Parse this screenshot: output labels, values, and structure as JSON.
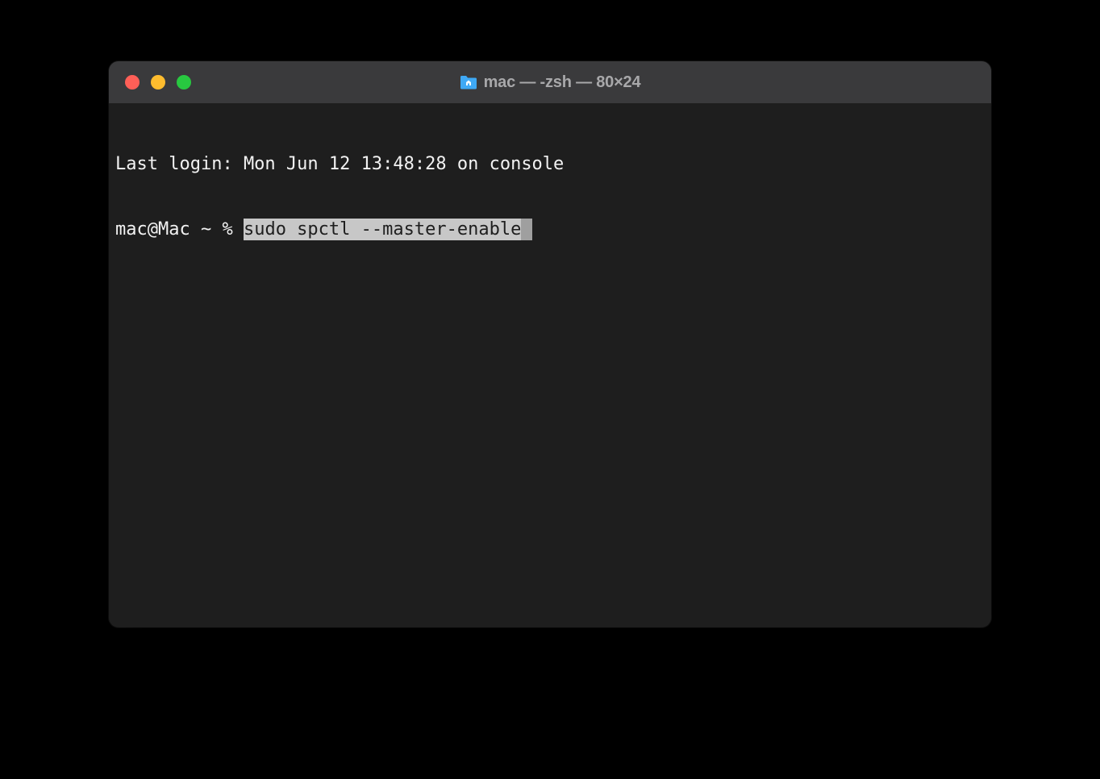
{
  "window": {
    "title": "mac — -zsh — 80×24",
    "icon": "folder-home-icon"
  },
  "terminal": {
    "login_line": "Last login: Mon Jun 12 13:48:28 on console",
    "prompt": "mac@Mac ~ % ",
    "command": "sudo spctl --master-enable"
  }
}
